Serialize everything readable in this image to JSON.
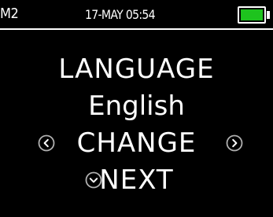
{
  "status_bar": {
    "device_id": "M2",
    "datetime": "17-MAY 05:54",
    "battery_level": 1.0,
    "battery_color": "#1ec31e"
  },
  "screen": {
    "title": "LANGUAGE",
    "current_value": "English",
    "change_label": "CHANGE",
    "next_label": "NEXT"
  },
  "icons": {
    "previous": "chevron-left-icon",
    "next_option": "chevron-right-icon",
    "advance": "chevron-down-icon"
  },
  "colors": {
    "background": "#000000",
    "foreground": "#ffffff",
    "icon_ring": "#b0b0b0"
  }
}
